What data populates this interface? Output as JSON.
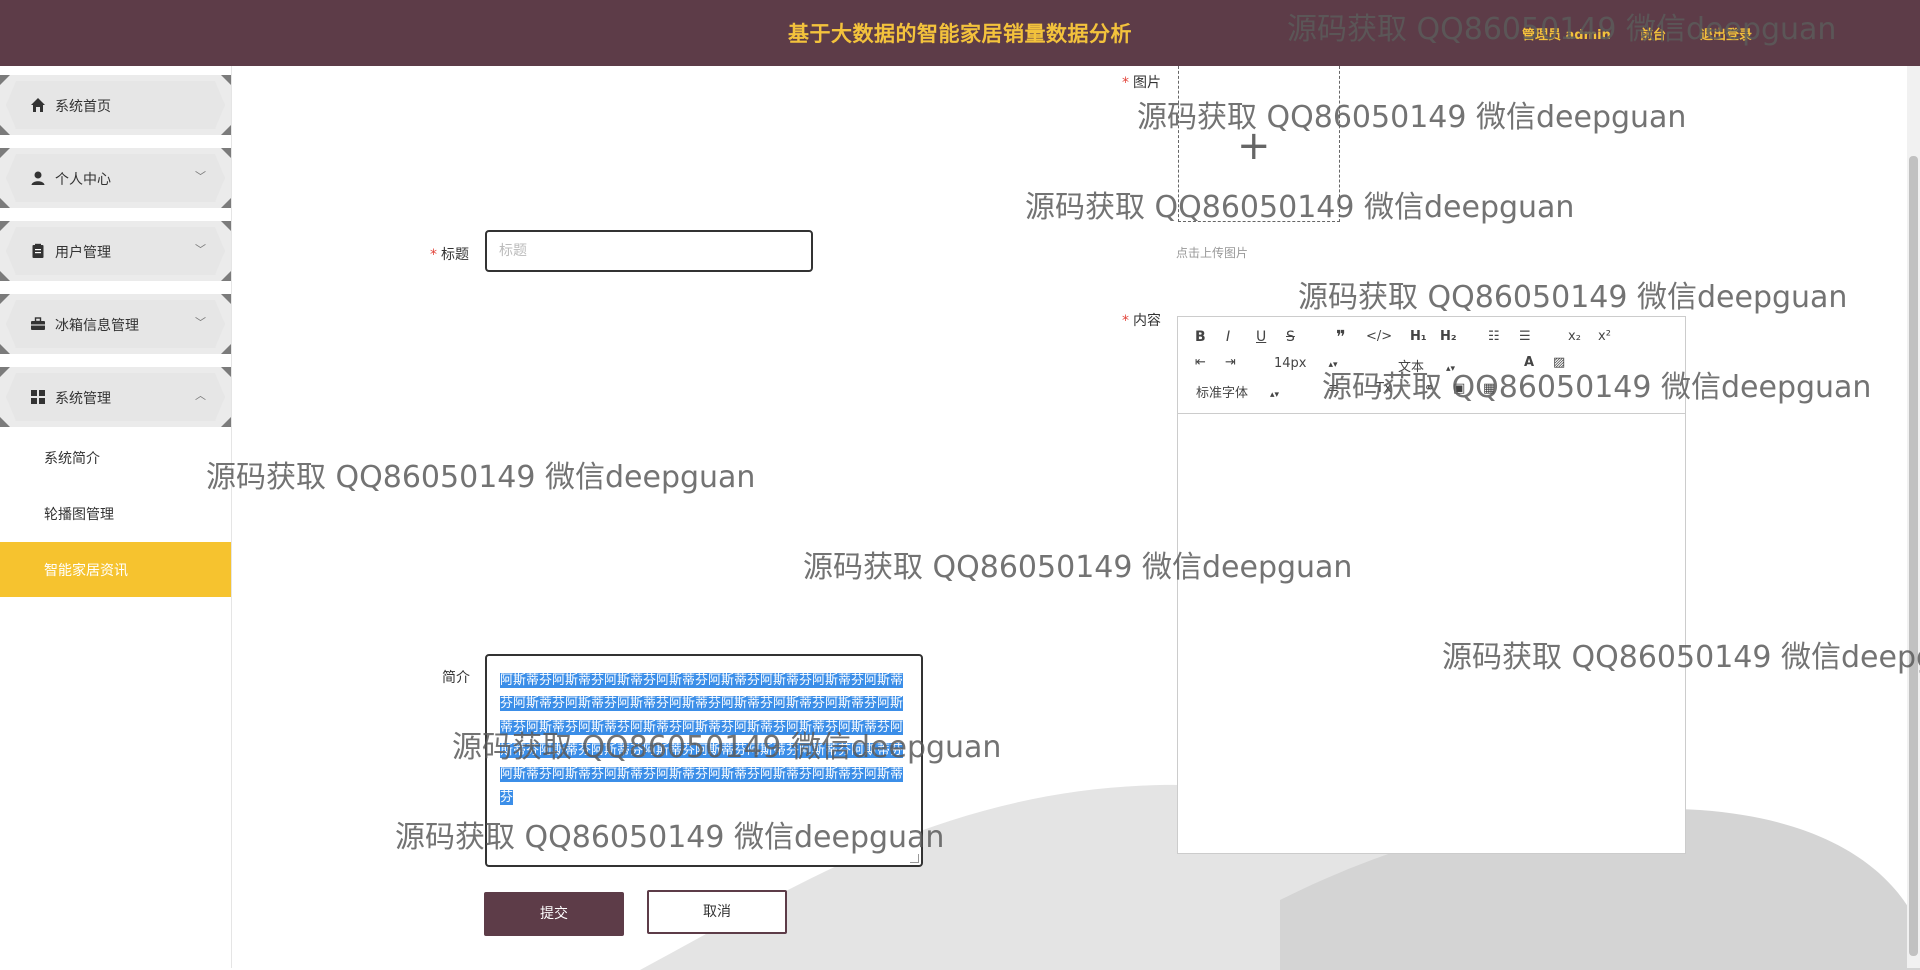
{
  "header": {
    "title": "基于大数据的智能家居销量数据分析",
    "user": "管理员 admin",
    "front_link": "前台",
    "logout_link": "退出登录"
  },
  "sidebar": {
    "items": [
      {
        "label": "系统首页",
        "icon": "home-icon"
      },
      {
        "label": "个人中心",
        "icon": "user-icon"
      },
      {
        "label": "用户管理",
        "icon": "clipboard-icon"
      },
      {
        "label": "冰箱信息管理",
        "icon": "briefcase-icon"
      },
      {
        "label": "系统管理",
        "icon": "grid-icon"
      }
    ],
    "sub_items": [
      {
        "label": "系统简介"
      },
      {
        "label": "轮播图管理"
      },
      {
        "label": "智能家居资讯",
        "active": true
      }
    ]
  },
  "form": {
    "image_label": "图片",
    "upload_tip": "点击上传图片",
    "title_label": "标题",
    "title_placeholder": "标题",
    "title_value": "",
    "content_label": "内容",
    "intro_label": "简介",
    "intro_value": "阿斯蒂芬阿斯蒂芬阿斯蒂芬阿斯蒂芬阿斯蒂芬阿斯蒂芬阿斯蒂芬阿斯蒂芬阿斯蒂芬阿斯蒂芬阿斯蒂芬阿斯蒂芬阿斯蒂芬阿斯蒂芬阿斯蒂芬阿斯蒂芬阿斯蒂芬阿斯蒂芬阿斯蒂芬阿斯蒂芬阿斯蒂芬阿斯蒂芬阿斯蒂芬阿斯蒂芬阿斯蒂芬阿斯蒂芬阿斯蒂芬阿斯蒂芬阿斯蒂芬阿斯蒂芬阿斯蒂芬阿斯蒂芬阿斯蒂芬阿斯蒂芬阿斯蒂芬阿斯蒂芬阿斯蒂芬阿斯蒂芬阿斯蒂芬",
    "submit_label": "提交",
    "cancel_label": "取消"
  },
  "editor": {
    "font_size": "14px",
    "header_select": "文本",
    "font_family": "标准字体"
  },
  "watermark": "源码获取 QQ86050149 微信deepguan",
  "colors": {
    "header_bg": "#5d3c48",
    "accent": "#f6c32f",
    "selection": "#3b8ee8"
  }
}
